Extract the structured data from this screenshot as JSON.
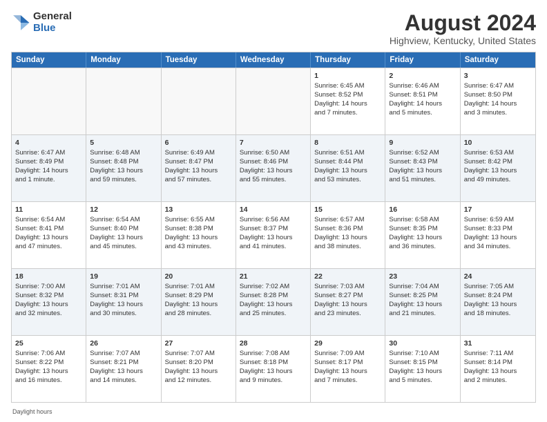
{
  "logo": {
    "general": "General",
    "blue": "Blue"
  },
  "title": "August 2024",
  "subtitle": "Highview, Kentucky, United States",
  "daylight_note": "Daylight hours",
  "header_days": [
    "Sunday",
    "Monday",
    "Tuesday",
    "Wednesday",
    "Thursday",
    "Friday",
    "Saturday"
  ],
  "rows": [
    {
      "alt": false,
      "cells": [
        {
          "empty": true,
          "day": "",
          "lines": []
        },
        {
          "empty": true,
          "day": "",
          "lines": []
        },
        {
          "empty": true,
          "day": "",
          "lines": []
        },
        {
          "empty": true,
          "day": "",
          "lines": []
        },
        {
          "empty": false,
          "day": "1",
          "lines": [
            "Sunrise: 6:45 AM",
            "Sunset: 8:52 PM",
            "Daylight: 14 hours",
            "and 7 minutes."
          ]
        },
        {
          "empty": false,
          "day": "2",
          "lines": [
            "Sunrise: 6:46 AM",
            "Sunset: 8:51 PM",
            "Daylight: 14 hours",
            "and 5 minutes."
          ]
        },
        {
          "empty": false,
          "day": "3",
          "lines": [
            "Sunrise: 6:47 AM",
            "Sunset: 8:50 PM",
            "Daylight: 14 hours",
            "and 3 minutes."
          ]
        }
      ]
    },
    {
      "alt": true,
      "cells": [
        {
          "empty": false,
          "day": "4",
          "lines": [
            "Sunrise: 6:47 AM",
            "Sunset: 8:49 PM",
            "Daylight: 14 hours",
            "and 1 minute."
          ]
        },
        {
          "empty": false,
          "day": "5",
          "lines": [
            "Sunrise: 6:48 AM",
            "Sunset: 8:48 PM",
            "Daylight: 13 hours",
            "and 59 minutes."
          ]
        },
        {
          "empty": false,
          "day": "6",
          "lines": [
            "Sunrise: 6:49 AM",
            "Sunset: 8:47 PM",
            "Daylight: 13 hours",
            "and 57 minutes."
          ]
        },
        {
          "empty": false,
          "day": "7",
          "lines": [
            "Sunrise: 6:50 AM",
            "Sunset: 8:46 PM",
            "Daylight: 13 hours",
            "and 55 minutes."
          ]
        },
        {
          "empty": false,
          "day": "8",
          "lines": [
            "Sunrise: 6:51 AM",
            "Sunset: 8:44 PM",
            "Daylight: 13 hours",
            "and 53 minutes."
          ]
        },
        {
          "empty": false,
          "day": "9",
          "lines": [
            "Sunrise: 6:52 AM",
            "Sunset: 8:43 PM",
            "Daylight: 13 hours",
            "and 51 minutes."
          ]
        },
        {
          "empty": false,
          "day": "10",
          "lines": [
            "Sunrise: 6:53 AM",
            "Sunset: 8:42 PM",
            "Daylight: 13 hours",
            "and 49 minutes."
          ]
        }
      ]
    },
    {
      "alt": false,
      "cells": [
        {
          "empty": false,
          "day": "11",
          "lines": [
            "Sunrise: 6:54 AM",
            "Sunset: 8:41 PM",
            "Daylight: 13 hours",
            "and 47 minutes."
          ]
        },
        {
          "empty": false,
          "day": "12",
          "lines": [
            "Sunrise: 6:54 AM",
            "Sunset: 8:40 PM",
            "Daylight: 13 hours",
            "and 45 minutes."
          ]
        },
        {
          "empty": false,
          "day": "13",
          "lines": [
            "Sunrise: 6:55 AM",
            "Sunset: 8:38 PM",
            "Daylight: 13 hours",
            "and 43 minutes."
          ]
        },
        {
          "empty": false,
          "day": "14",
          "lines": [
            "Sunrise: 6:56 AM",
            "Sunset: 8:37 PM",
            "Daylight: 13 hours",
            "and 41 minutes."
          ]
        },
        {
          "empty": false,
          "day": "15",
          "lines": [
            "Sunrise: 6:57 AM",
            "Sunset: 8:36 PM",
            "Daylight: 13 hours",
            "and 38 minutes."
          ]
        },
        {
          "empty": false,
          "day": "16",
          "lines": [
            "Sunrise: 6:58 AM",
            "Sunset: 8:35 PM",
            "Daylight: 13 hours",
            "and 36 minutes."
          ]
        },
        {
          "empty": false,
          "day": "17",
          "lines": [
            "Sunrise: 6:59 AM",
            "Sunset: 8:33 PM",
            "Daylight: 13 hours",
            "and 34 minutes."
          ]
        }
      ]
    },
    {
      "alt": true,
      "cells": [
        {
          "empty": false,
          "day": "18",
          "lines": [
            "Sunrise: 7:00 AM",
            "Sunset: 8:32 PM",
            "Daylight: 13 hours",
            "and 32 minutes."
          ]
        },
        {
          "empty": false,
          "day": "19",
          "lines": [
            "Sunrise: 7:01 AM",
            "Sunset: 8:31 PM",
            "Daylight: 13 hours",
            "and 30 minutes."
          ]
        },
        {
          "empty": false,
          "day": "20",
          "lines": [
            "Sunrise: 7:01 AM",
            "Sunset: 8:29 PM",
            "Daylight: 13 hours",
            "and 28 minutes."
          ]
        },
        {
          "empty": false,
          "day": "21",
          "lines": [
            "Sunrise: 7:02 AM",
            "Sunset: 8:28 PM",
            "Daylight: 13 hours",
            "and 25 minutes."
          ]
        },
        {
          "empty": false,
          "day": "22",
          "lines": [
            "Sunrise: 7:03 AM",
            "Sunset: 8:27 PM",
            "Daylight: 13 hours",
            "and 23 minutes."
          ]
        },
        {
          "empty": false,
          "day": "23",
          "lines": [
            "Sunrise: 7:04 AM",
            "Sunset: 8:25 PM",
            "Daylight: 13 hours",
            "and 21 minutes."
          ]
        },
        {
          "empty": false,
          "day": "24",
          "lines": [
            "Sunrise: 7:05 AM",
            "Sunset: 8:24 PM",
            "Daylight: 13 hours",
            "and 18 minutes."
          ]
        }
      ]
    },
    {
      "alt": false,
      "cells": [
        {
          "empty": false,
          "day": "25",
          "lines": [
            "Sunrise: 7:06 AM",
            "Sunset: 8:22 PM",
            "Daylight: 13 hours",
            "and 16 minutes."
          ]
        },
        {
          "empty": false,
          "day": "26",
          "lines": [
            "Sunrise: 7:07 AM",
            "Sunset: 8:21 PM",
            "Daylight: 13 hours",
            "and 14 minutes."
          ]
        },
        {
          "empty": false,
          "day": "27",
          "lines": [
            "Sunrise: 7:07 AM",
            "Sunset: 8:20 PM",
            "Daylight: 13 hours",
            "and 12 minutes."
          ]
        },
        {
          "empty": false,
          "day": "28",
          "lines": [
            "Sunrise: 7:08 AM",
            "Sunset: 8:18 PM",
            "Daylight: 13 hours",
            "and 9 minutes."
          ]
        },
        {
          "empty": false,
          "day": "29",
          "lines": [
            "Sunrise: 7:09 AM",
            "Sunset: 8:17 PM",
            "Daylight: 13 hours",
            "and 7 minutes."
          ]
        },
        {
          "empty": false,
          "day": "30",
          "lines": [
            "Sunrise: 7:10 AM",
            "Sunset: 8:15 PM",
            "Daylight: 13 hours",
            "and 5 minutes."
          ]
        },
        {
          "empty": false,
          "day": "31",
          "lines": [
            "Sunrise: 7:11 AM",
            "Sunset: 8:14 PM",
            "Daylight: 13 hours",
            "and 2 minutes."
          ]
        }
      ]
    }
  ]
}
